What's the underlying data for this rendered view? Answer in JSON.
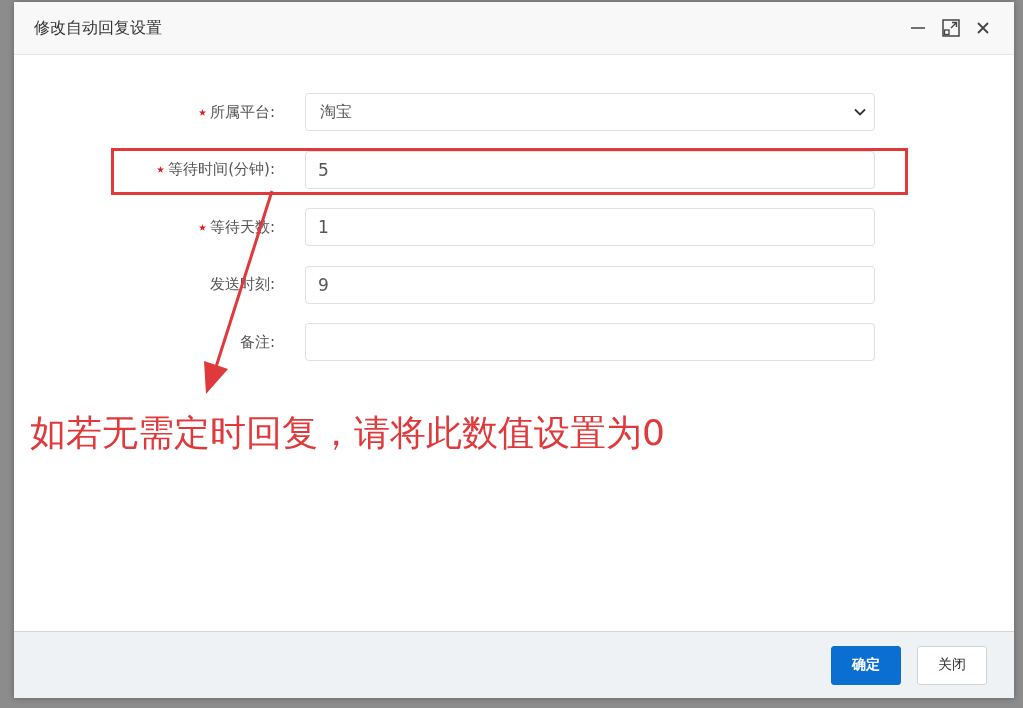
{
  "dialog": {
    "title": "修改自动回复设置"
  },
  "fields": [
    {
      "kind": "select",
      "label": "所属平台:",
      "required": true,
      "value": "淘宝"
    },
    {
      "kind": "input",
      "label": "等待时间(分钟):",
      "required": true,
      "value": "5"
    },
    {
      "kind": "input",
      "label": "等待天数:",
      "required": true,
      "value": "1"
    },
    {
      "kind": "input",
      "label": "发送时刻:",
      "required": false,
      "value": "9"
    },
    {
      "kind": "input",
      "label": "备注:",
      "required": false
    }
  ],
  "annotation": {
    "text": "如若无需定时回复，请将此数值设置为0"
  },
  "buttons": [
    {
      "label": "确定",
      "primary": true
    },
    {
      "label": "关闭",
      "primary": false
    }
  ]
}
